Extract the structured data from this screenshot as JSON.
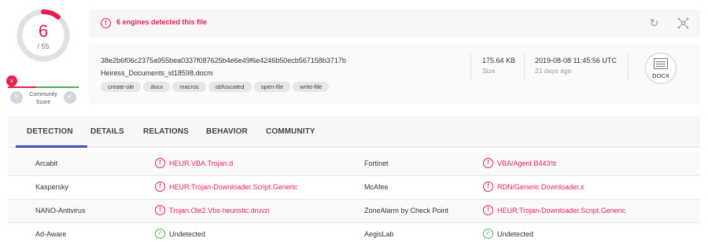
{
  "score": {
    "detections": "6",
    "total": "/ 55",
    "ring_color": "#e91e4a",
    "detection_fraction": 0.109
  },
  "community": {
    "label": "Community Score",
    "marker": "×",
    "down_glyph": "×",
    "up_glyph": "✓"
  },
  "banner": {
    "alert_icon": "alert-circle-icon",
    "alert_glyph": "!",
    "message": "6 engines detected this file",
    "reload_icon": "reload-icon",
    "reload_glyph": "↻",
    "graph_icon": "graph-icon"
  },
  "file": {
    "hash": "38e2b6f06c2375a955bea0337f087625b4e6e49f6e4246b50ecb567158b3717b",
    "name": "Heiress_Documents_id18598.docm",
    "tags": [
      "create-ole",
      "docx",
      "macros",
      "obfuscated",
      "open-file",
      "write-file"
    ],
    "size_value": "175.64 KB",
    "size_label": "Size",
    "date_value": "2019-08-08 11:45:56 UTC",
    "date_label": "21 days ago",
    "type_label": "DOCX",
    "type_icon": "docx-file-icon"
  },
  "tabs": [
    "DETECTION",
    "DETAILS",
    "RELATIONS",
    "BEHAVIOR",
    "COMMUNITY"
  ],
  "active_tab": "DETECTION",
  "detections": [
    {
      "left": {
        "engine": "Arcabit",
        "result": "HEUR.VBA.Trojan.d",
        "status": "detected"
      },
      "right": {
        "engine": "Fortinet",
        "result": "VBA/Agent.B443!tr",
        "status": "detected"
      }
    },
    {
      "left": {
        "engine": "Kaspersky",
        "result": "HEUR:Trojan-Downloader.Script.Generic",
        "status": "detected"
      },
      "right": {
        "engine": "McAfee",
        "result": "RDN/Generic Downloader.x",
        "status": "detected"
      }
    },
    {
      "left": {
        "engine": "NANO-Antivirus",
        "result": "Trojan.Ole2.Vbs-heuristic.druvzi",
        "status": "detected"
      },
      "right": {
        "engine": "ZoneAlarm by Check Point",
        "result": "HEUR:Trojan-Downloader.Script.Generic",
        "status": "detected"
      }
    },
    {
      "left": {
        "engine": "Ad-Aware",
        "result": "Undetected",
        "status": "undetected"
      },
      "right": {
        "engine": "AegisLab",
        "result": "Undetected",
        "status": "undetected"
      }
    }
  ],
  "status_glyphs": {
    "detected": "!",
    "undetected": "✓"
  },
  "colors": {
    "alert": "#e91e4a",
    "clean": "#4caf50",
    "accent": "#3f51b5"
  }
}
